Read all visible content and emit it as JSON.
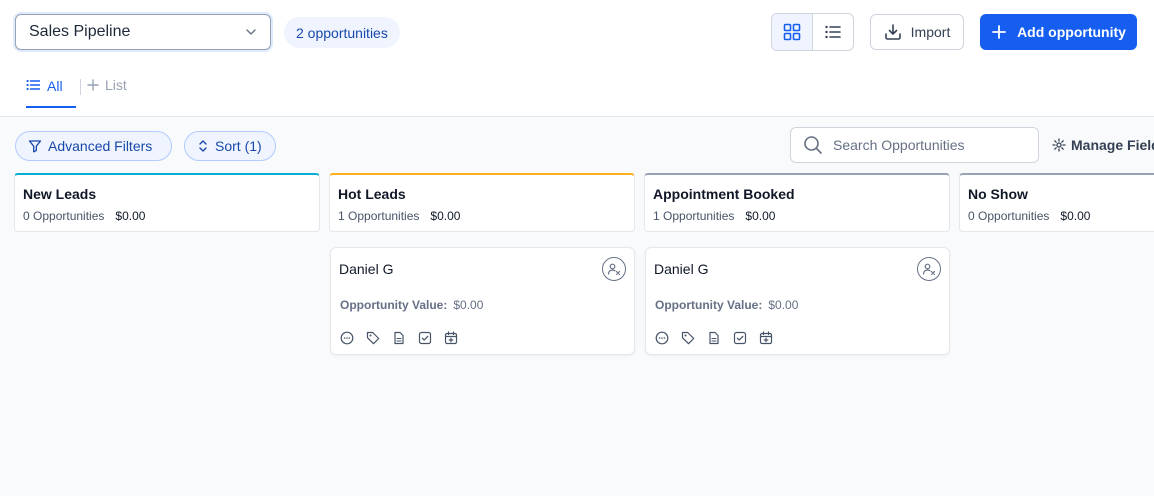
{
  "header": {
    "pipeline": "Sales Pipeline",
    "count": "2 opportunities",
    "import_label": "Import",
    "add_label": "Add opportunity"
  },
  "tabs": {
    "all": "All",
    "list": "List"
  },
  "toolbar": {
    "filters": "Advanced Filters",
    "sort": "Sort (1)",
    "search_placeholder": "Search Opportunities",
    "manage": "Manage Fields"
  },
  "colors": {
    "primary": "#155eef",
    "stage_new_leads": "#06aed4",
    "stage_hot_leads": "#fdb022",
    "stage_appointment": "#98a2b3",
    "stage_no_show": "#98a2b3"
  },
  "stages": [
    {
      "name": "New Leads",
      "count": "0 Opportunities",
      "total": "$0.00"
    },
    {
      "name": "Hot Leads",
      "count": "1 Opportunities",
      "total": "$0.00"
    },
    {
      "name": "Appointment Booked",
      "count": "1 Opportunities",
      "total": "$0.00"
    },
    {
      "name": "No Show",
      "count": "0 Opportunities",
      "total": "$0.00"
    }
  ],
  "cards": [
    {
      "name": "Daniel G",
      "value_label": "Opportunity Value:",
      "value": "$0.00"
    },
    {
      "name": "Daniel G",
      "value_label": "Opportunity Value:",
      "value": "$0.00"
    }
  ]
}
